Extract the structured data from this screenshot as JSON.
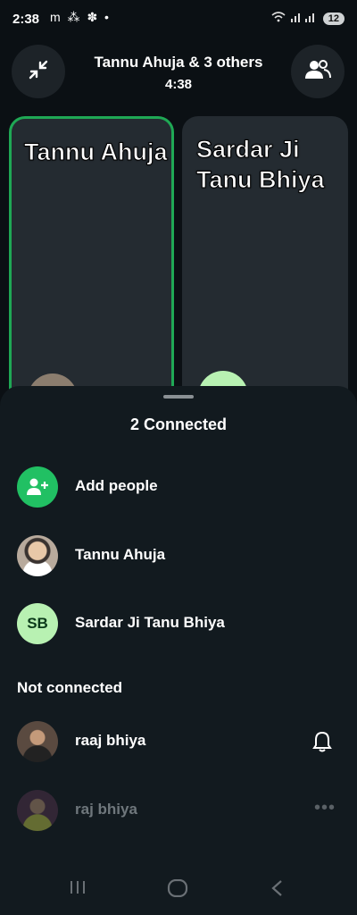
{
  "status_bar": {
    "time": "2:38",
    "notification_icons": "m ⁂ ✽ •",
    "battery": "12"
  },
  "header": {
    "title": "Tannu Ahuja & 3 others",
    "timer": "4:38",
    "minimize_icon": "minimize-arrows-icon",
    "people_icon": "people-icon"
  },
  "tiles": [
    {
      "name": "Tannu Ahuja",
      "speaking": true
    },
    {
      "name": "Sardar Ji Tanu Bhiya",
      "speaking": false
    }
  ],
  "sheet": {
    "title": "2 Connected",
    "add_people": "Add people",
    "connected": [
      {
        "name": "Tannu Ahuja",
        "avatar": "photo"
      },
      {
        "name": "Sardar Ji Tanu Bhiya",
        "initials": "SB"
      }
    ],
    "not_connected_title": "Not connected",
    "not_connected": [
      {
        "name": "raaj bhiya",
        "action_icon": "bell-icon"
      },
      {
        "name": "raj bhiya",
        "action_icon": "more-dots-icon"
      }
    ]
  },
  "colors": {
    "accent_green": "#21c063",
    "background": "#0b1014",
    "sheet": "#121a1f"
  }
}
